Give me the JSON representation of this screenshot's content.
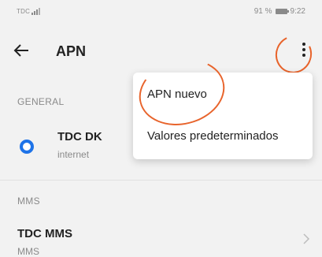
{
  "status_bar": {
    "carrier": "TDC",
    "battery": "91 %",
    "time": "9:22"
  },
  "app_bar": {
    "title": "APN",
    "back_icon": "arrow-left-icon",
    "more_icon": "more-vertical-icon"
  },
  "sections": {
    "general_label": "GENERAL",
    "mms_label": "MMS"
  },
  "apn": {
    "name": "TDC DK",
    "type": "internet",
    "selected": true
  },
  "mms": {
    "name": "TDC MMS",
    "type": "MMS"
  },
  "menu": {
    "items": [
      {
        "label": "APN nuevo"
      },
      {
        "label": "Valores predeterminados"
      }
    ]
  },
  "colors": {
    "accent": "#1e73e8",
    "annotation": "#e8642c",
    "background": "#f2f2f2"
  }
}
